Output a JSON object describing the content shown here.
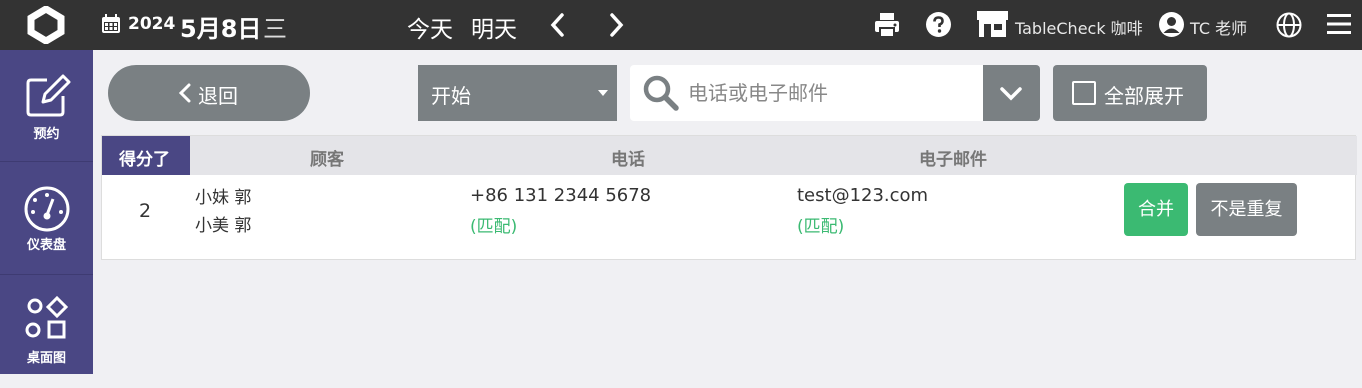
{
  "header": {
    "date_year": "2024",
    "date_month_day": "5月8日",
    "date_weekday": "三",
    "today_label": "今天",
    "tomorrow_label": "明天",
    "store_name": "TableCheck 咖啡",
    "user_name": "TC 老师",
    "icons": [
      "logo-icon",
      "calendar-icon",
      "chevron-left-icon",
      "chevron-right-icon",
      "print-icon",
      "help-icon",
      "store-icon",
      "user-icon",
      "globe-icon",
      "menu-icon"
    ]
  },
  "sidebar": {
    "items": [
      {
        "label": "预约",
        "icon": "edit-icon"
      },
      {
        "label": "仪表盘",
        "icon": "dashboard-icon"
      },
      {
        "label": "桌面图",
        "icon": "shapes-icon"
      }
    ]
  },
  "toolbar": {
    "back_label": "退回",
    "select_value": "开始",
    "search_placeholder": "电话或电子邮件",
    "expand_all_label": "全部展开"
  },
  "table": {
    "columns": {
      "score": "得分了",
      "customer": "顾客",
      "phone": "电话",
      "email": "电子邮件"
    },
    "rows": [
      {
        "score": "2",
        "name_1": "小妹 郭",
        "name_2": "小美 郭",
        "phone": "+86 131 2344 5678",
        "phone_match": "(匹配)",
        "email": "test@123.com",
        "email_match": "(匹配)",
        "merge_label": "合并",
        "not_duplicate_label": "不是重复"
      }
    ]
  },
  "colors": {
    "topbar": "#333333",
    "sidebar": "#4a4784",
    "button_gray": "#7a8083",
    "match_green": "#3bba72"
  }
}
